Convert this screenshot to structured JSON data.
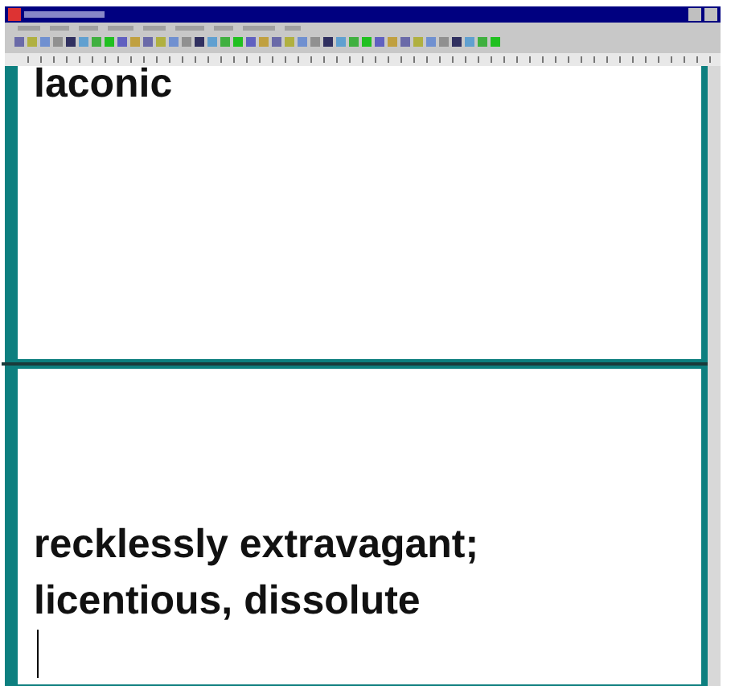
{
  "document": {
    "pages": [
      {
        "lines": [
          "laconic"
        ]
      },
      {
        "lines": [
          "recklessly extravagant;",
          "licentious, dissolute"
        ],
        "cursor": true
      }
    ]
  }
}
